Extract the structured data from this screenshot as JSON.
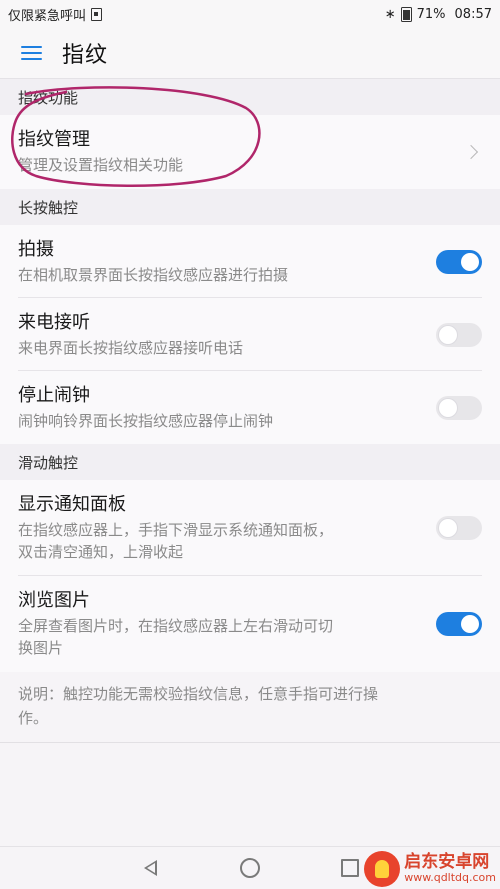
{
  "status_bar": {
    "carrier": "仅限紧急呼叫",
    "battery": "71%",
    "time": "08:57"
  },
  "app_bar": {
    "title": "指纹",
    "menu_icon": "hamburger-menu-icon"
  },
  "sections": {
    "fingerprint_function": {
      "header": "指纹功能",
      "items": [
        {
          "title": "指纹管理",
          "subtitle": "管理及设置指纹相关功能"
        }
      ]
    },
    "long_press": {
      "header": "长按触控",
      "items": [
        {
          "title": "拍摄",
          "subtitle": "在相机取景界面长按指纹感应器进行拍摄",
          "toggle": true
        },
        {
          "title": "来电接听",
          "subtitle": "来电界面长按指纹感应器接听电话",
          "toggle": false
        },
        {
          "title": "停止闹钟",
          "subtitle": "闹钟响铃界面长按指纹感应器停止闹钟",
          "toggle": false
        }
      ]
    },
    "swipe": {
      "header": "滑动触控",
      "items": [
        {
          "title": "显示通知面板",
          "subtitle_line1": "在指纹感应器上，手指下滑显示系统通知面板，",
          "subtitle_line2": "双击清空通知，上滑收起",
          "toggle": false
        },
        {
          "title": "浏览图片",
          "subtitle_line1": "全屏查看图片时，在指纹感应器上左右滑动可切",
          "subtitle_line2": "换图片",
          "toggle": true
        }
      ]
    }
  },
  "note": {
    "line1": "说明：触控功能无需校验指纹信息，任意手指可进行操",
    "line2": "作。"
  },
  "watermark": {
    "title": "启东安卓网",
    "url": "www.qdltdq.com"
  },
  "colors": {
    "accent": "#1e7fe0",
    "annotation": "#b0266a"
  }
}
